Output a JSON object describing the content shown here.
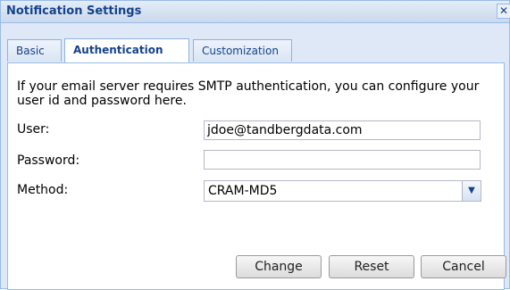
{
  "window": {
    "title": "Notification Settings",
    "close_icon": "close-icon"
  },
  "tabs": [
    {
      "label": "Basic",
      "active": false
    },
    {
      "label": "Authentication",
      "active": true
    },
    {
      "label": "Customization",
      "active": false
    }
  ],
  "auth": {
    "description": "If your email server requires SMTP authentication, you can configure your user id and password here.",
    "user_label": "User:",
    "user_value": "jdoe@tandbergdata.com",
    "password_label": "Password:",
    "password_value": "",
    "method_label": "Method:",
    "method_value": "CRAM-MD5"
  },
  "buttons": {
    "change": "Change",
    "reset": "Reset",
    "cancel": "Cancel"
  }
}
